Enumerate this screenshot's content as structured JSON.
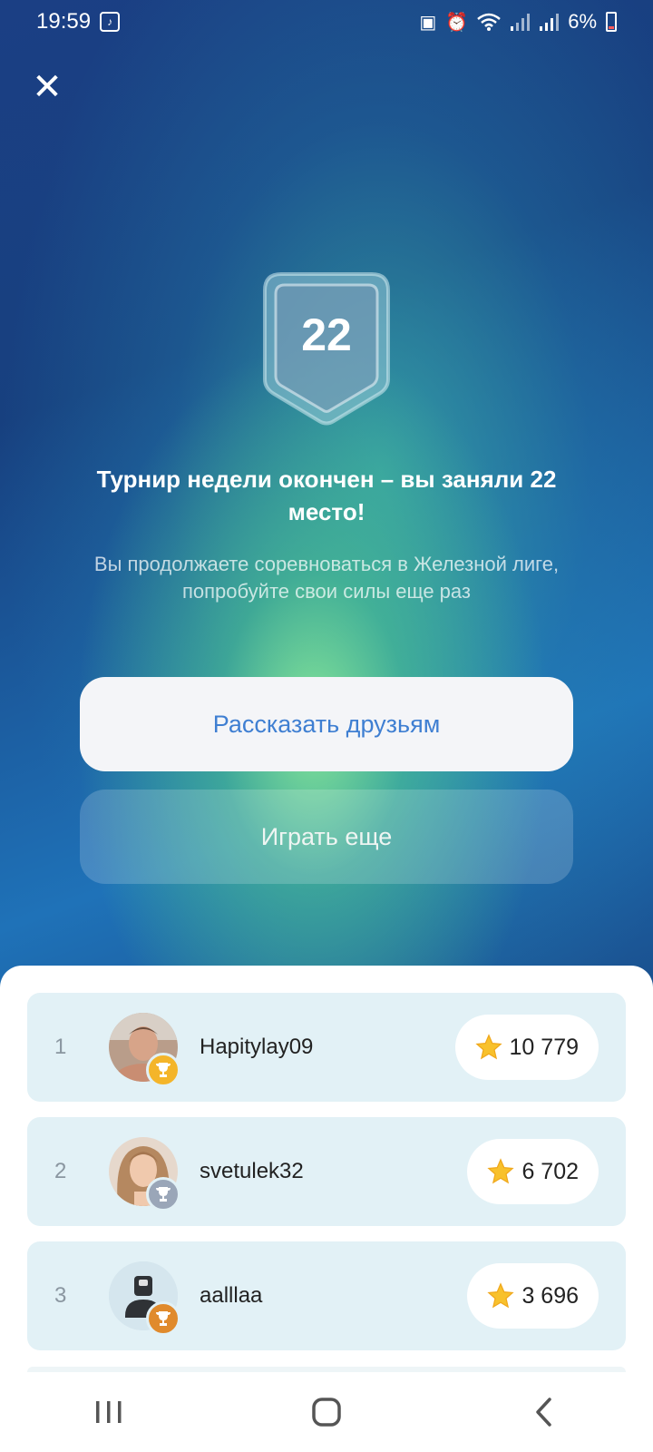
{
  "status_bar": {
    "time": "19:59",
    "battery": "6%",
    "icons": [
      "notification-icon",
      "saver-icon",
      "alarm-icon",
      "wifi-icon",
      "signal-icon",
      "signal-icon",
      "battery-icon"
    ]
  },
  "close_icon": "close-icon",
  "result": {
    "place": "22",
    "headline": "Турнир недели окончен – вы заняли 22 место!",
    "subtext": "Вы продолжаете соревноваться в Железной лиге, попробуйте свои силы еще раз"
  },
  "buttons": {
    "share": "Рассказать друзьям",
    "play_again": "Играть еще"
  },
  "leaderboard": [
    {
      "rank": "1",
      "username": "Hapitylay09",
      "score": "10 779",
      "trophy": "gold"
    },
    {
      "rank": "2",
      "username": "svetulek32",
      "score": "6 702",
      "trophy": "silver"
    },
    {
      "rank": "3",
      "username": "aalllaa",
      "score": "3 696",
      "trophy": "bronze"
    }
  ],
  "colors": {
    "accent": "#3f7fd2",
    "gold": "#f4b52a",
    "silver": "#9aa6b8",
    "bronze": "#e08a2c",
    "row_bg": "#e2f1f6"
  },
  "navbar": [
    "recents-icon",
    "home-icon",
    "back-icon"
  ]
}
